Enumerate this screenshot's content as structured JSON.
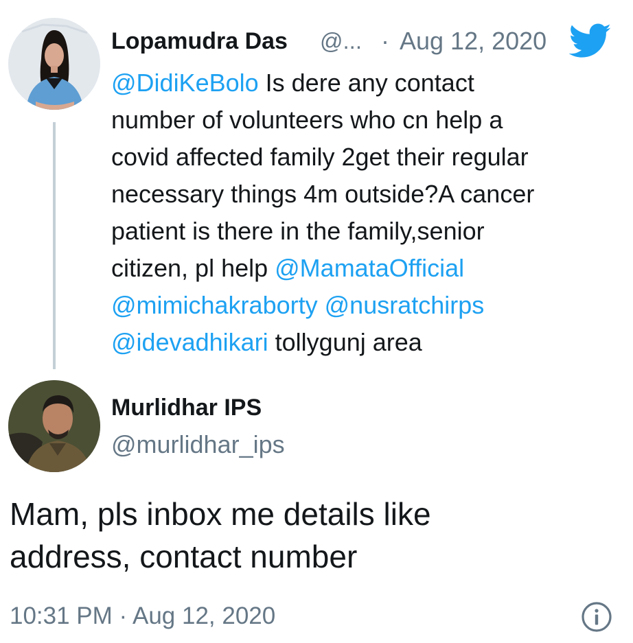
{
  "parent_tweet": {
    "author_name": "Lopamudra Das",
    "author_handle_truncated": "@...",
    "separator": "·",
    "date": "Aug 12, 2020",
    "lines": [
      [
        {
          "t": "@DidiKeBolo",
          "m": true
        },
        {
          "t": " Is dere any contact",
          "m": false
        }
      ],
      [
        {
          "t": "number of volunteers who cn help a",
          "m": false
        }
      ],
      [
        {
          "t": "covid affected family 2get their regular",
          "m": false
        }
      ],
      [
        {
          "t": "necessary things 4m outside?A cancer",
          "m": false
        }
      ],
      [
        {
          "t": "patient is there in the family,senior",
          "m": false
        }
      ],
      [
        {
          "t": "citizen, pl help ",
          "m": false
        },
        {
          "t": "@MamataOfficial",
          "m": true
        }
      ],
      [
        {
          "t": "@mimichakraborty",
          "m": true
        },
        {
          "t": " ",
          "m": false
        },
        {
          "t": "@nusratchirps",
          "m": true
        }
      ],
      [
        {
          "t": "@idevadhikari",
          "m": true
        },
        {
          "t": " tollygunj area",
          "m": false
        }
      ]
    ]
  },
  "reply_tweet": {
    "author_name": "Murlidhar IPS",
    "author_handle": "@murlidhar_ips",
    "lines": [
      "Mam, pls inbox me details like",
      "address, contact number"
    ],
    "time": "10:31 PM",
    "separator": "·",
    "date": "Aug 12, 2020"
  },
  "icons": {
    "brand": "twitter-bird-icon",
    "info": "info-icon"
  },
  "colors": {
    "link": "#1da1f2",
    "text": "#14171a",
    "muted": "#657786",
    "thread_line": "#c4cfd6"
  }
}
